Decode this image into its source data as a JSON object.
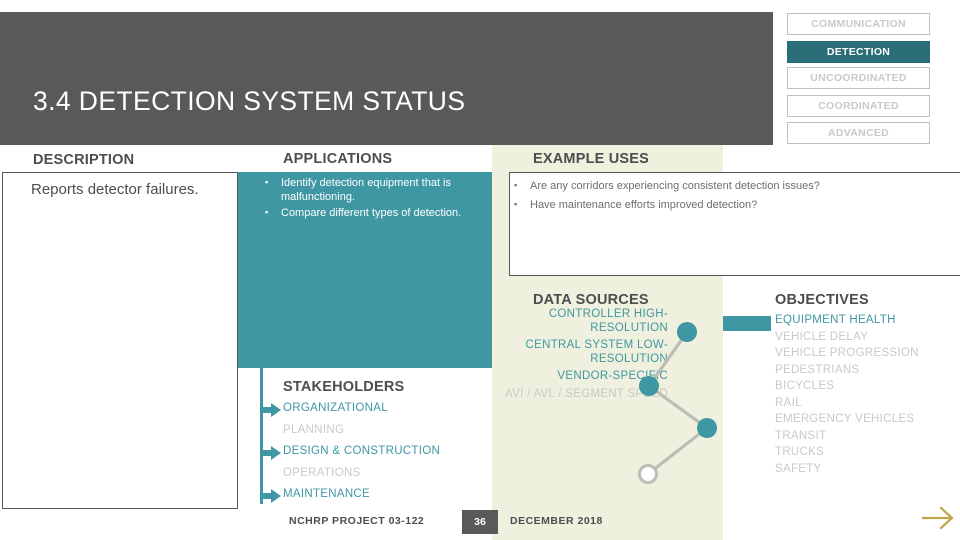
{
  "header": {
    "title": "3.4 DETECTION SYSTEM STATUS",
    "bar_color": "#58595b"
  },
  "nav_chips": [
    {
      "label": "COMMUNICATION",
      "active": false
    },
    {
      "label": "DETECTION",
      "active": true
    },
    {
      "label": "UNCOORDINATED",
      "active": false
    },
    {
      "label": "COORDINATED",
      "active": false
    },
    {
      "label": "ADVANCED",
      "active": false
    }
  ],
  "sections": {
    "description": {
      "heading": "DESCRIPTION",
      "text": "Reports detector failures."
    },
    "applications": {
      "heading": "APPLICATIONS",
      "items": [
        "Identify detection equipment that is malfunctioning.",
        "Compare different types of detection."
      ],
      "panel_color": "#3f97a3"
    },
    "example_uses": {
      "heading": "EXAMPLE USES",
      "items": [
        "Are any corridors experiencing consistent detection issues?",
        "Have maintenance efforts improved detection?"
      ]
    },
    "data_sources": {
      "heading": "DATA SOURCES",
      "items": [
        {
          "label": "CONTROLLER HIGH-RESOLUTION",
          "active": true
        },
        {
          "label": "CENTRAL SYSTEM LOW-RESOLUTION",
          "active": true
        },
        {
          "label": "VENDOR-SPECIFIC",
          "active": true
        },
        {
          "label": "AVI / AVL / SEGMENT SPEED",
          "active": false
        }
      ],
      "nodes": [
        {
          "label": "CONTROLLER HIGH-RESOLUTION",
          "filled": true
        },
        {
          "label": "CENTRAL SYSTEM LOW-RESOLUTION",
          "filled": true
        },
        {
          "label": "VENDOR-SPECIFIC",
          "filled": true
        },
        {
          "label": "AVI / AVL / SEGMENT SPEED",
          "filled": false
        }
      ]
    },
    "objectives": {
      "heading": "OBJECTIVES",
      "items": [
        {
          "label": "EQUIPMENT HEALTH",
          "active": true
        },
        {
          "label": "VEHICLE DELAY",
          "active": false
        },
        {
          "label": "VEHICLE PROGRESSION",
          "active": false
        },
        {
          "label": "PEDESTRIANS",
          "active": false
        },
        {
          "label": "BICYCLES",
          "active": false
        },
        {
          "label": "RAIL",
          "active": false
        },
        {
          "label": "EMERGENCY VEHICLES",
          "active": false
        },
        {
          "label": "TRANSIT",
          "active": false
        },
        {
          "label": "TRUCKS",
          "active": false
        },
        {
          "label": "SAFETY",
          "active": false
        }
      ]
    },
    "stakeholders": {
      "heading": "STAKEHOLDERS",
      "items": [
        {
          "label": "ORGANIZATIONAL",
          "active": true
        },
        {
          "label": "PLANNING",
          "active": false
        },
        {
          "label": "DESIGN & CONSTRUCTION",
          "active": true
        },
        {
          "label": "OPERATIONS",
          "active": false
        },
        {
          "label": "MAINTENANCE",
          "active": true
        }
      ]
    }
  },
  "footer": {
    "project": "NCHRP PROJECT 03-122",
    "page": "36",
    "date": "DECEMBER 2018"
  },
  "colors": {
    "teal": "#3f97a3",
    "dark_teal": "#2b6d76",
    "dark_gray": "#58595b",
    "beige": "#eff0dd",
    "muted": "#c9c9c9",
    "gold": "#c0a44e"
  }
}
